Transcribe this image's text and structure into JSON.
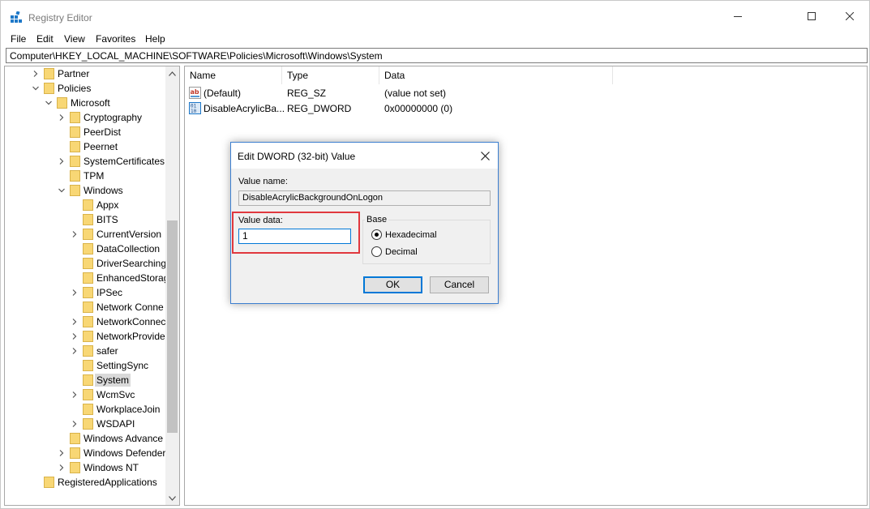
{
  "window": {
    "title": "Registry Editor"
  },
  "menu": [
    "File",
    "Edit",
    "View",
    "Favorites",
    "Help"
  ],
  "address": "Computer\\HKEY_LOCAL_MACHINE\\SOFTWARE\\Policies\\Microsoft\\Windows\\System",
  "tree": [
    {
      "label": "Partner",
      "depth": 0,
      "expander": "collapsed"
    },
    {
      "label": "Policies",
      "depth": 0,
      "expander": "expanded"
    },
    {
      "label": "Microsoft",
      "depth": 1,
      "expander": "expanded"
    },
    {
      "label": "Cryptography",
      "depth": 2,
      "expander": "collapsed"
    },
    {
      "label": "PeerDist",
      "depth": 2,
      "expander": "none"
    },
    {
      "label": "Peernet",
      "depth": 2,
      "expander": "none"
    },
    {
      "label": "SystemCertificates",
      "depth": 2,
      "expander": "collapsed"
    },
    {
      "label": "TPM",
      "depth": 2,
      "expander": "none"
    },
    {
      "label": "Windows",
      "depth": 2,
      "expander": "expanded"
    },
    {
      "label": "Appx",
      "depth": 3,
      "expander": "none"
    },
    {
      "label": "BITS",
      "depth": 3,
      "expander": "none"
    },
    {
      "label": "CurrentVersion",
      "depth": 3,
      "expander": "collapsed"
    },
    {
      "label": "DataCollection",
      "depth": 3,
      "expander": "none"
    },
    {
      "label": "DriverSearching",
      "depth": 3,
      "expander": "none"
    },
    {
      "label": "EnhancedStorag",
      "depth": 3,
      "expander": "none"
    },
    {
      "label": "IPSec",
      "depth": 3,
      "expander": "collapsed"
    },
    {
      "label": "Network Conne",
      "depth": 3,
      "expander": "none"
    },
    {
      "label": "NetworkConnec",
      "depth": 3,
      "expander": "collapsed"
    },
    {
      "label": "NetworkProvide",
      "depth": 3,
      "expander": "collapsed"
    },
    {
      "label": "safer",
      "depth": 3,
      "expander": "collapsed"
    },
    {
      "label": "SettingSync",
      "depth": 3,
      "expander": "none"
    },
    {
      "label": "System",
      "depth": 3,
      "expander": "none",
      "selected": true
    },
    {
      "label": "WcmSvc",
      "depth": 3,
      "expander": "collapsed"
    },
    {
      "label": "WorkplaceJoin",
      "depth": 3,
      "expander": "none"
    },
    {
      "label": "WSDAPI",
      "depth": 3,
      "expander": "collapsed"
    },
    {
      "label": "Windows Advance",
      "depth": 2,
      "expander": "none"
    },
    {
      "label": "Windows Defender",
      "depth": 2,
      "expander": "collapsed"
    },
    {
      "label": "Windows NT",
      "depth": 2,
      "expander": "collapsed"
    },
    {
      "label": "RegisteredApplications",
      "depth": 0,
      "expander": "none"
    }
  ],
  "list": {
    "columns": [
      "Name",
      "Type",
      "Data"
    ],
    "rows": [
      {
        "icon": "string-value-icon",
        "name": "(Default)",
        "type": "REG_SZ",
        "data": "(value not set)"
      },
      {
        "icon": "binary-value-icon",
        "name": "DisableAcrylicBa...",
        "type": "REG_DWORD",
        "data": "0x00000000 (0)"
      }
    ]
  },
  "dialog": {
    "title": "Edit DWORD (32-bit) Value",
    "value_name_label": "Value name:",
    "value_name": "DisableAcrylicBackgroundOnLogon",
    "value_data_label": "Value data:",
    "value_data": "1",
    "base_label": "Base",
    "base_options": [
      {
        "label": "Hexadecimal",
        "checked": true
      },
      {
        "label": "Decimal",
        "checked": false
      }
    ],
    "ok_label": "OK",
    "cancel_label": "Cancel"
  },
  "colors": {
    "highlight": "#e0383e",
    "accent": "#0078d7",
    "folder": "#f8d775"
  }
}
